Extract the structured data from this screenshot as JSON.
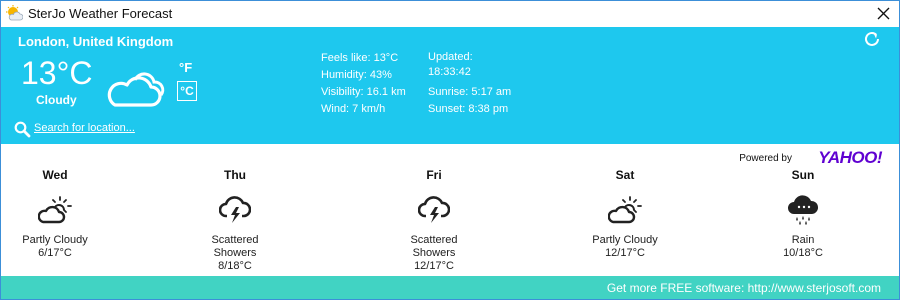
{
  "window": {
    "title": "SterJo Weather Forecast"
  },
  "current": {
    "location": "London, United Kingdom",
    "temperature": "13°C",
    "condition": "Cloudy",
    "unit_f": "°F",
    "unit_c": "°C",
    "feels_like": "Feels like: 13°C",
    "humidity": "Humidity: 43%",
    "visibility": "Visibility: 16.1 km",
    "wind": "Wind: 7 km/h",
    "updated_label": "Updated:",
    "updated_time": "18:33:42",
    "sunrise": "Sunrise: 5:17 am",
    "sunset": "Sunset: 8:38 pm",
    "search_link": "Search for location..."
  },
  "powered": {
    "label": "Powered by",
    "logo": "YAHOO!"
  },
  "forecast": [
    {
      "day": "Wed",
      "condition_line1": "Partly Cloudy",
      "condition_line2": "",
      "temps": "6/17°C",
      "icon": "partly-cloudy-icon"
    },
    {
      "day": "Thu",
      "condition_line1": "Scattered",
      "condition_line2": "Showers",
      "temps": "8/18°C",
      "icon": "thunder-shower-icon"
    },
    {
      "day": "Fri",
      "condition_line1": "Scattered",
      "condition_line2": "Showers",
      "temps": "12/17°C",
      "icon": "thunder-shower-icon"
    },
    {
      "day": "Sat",
      "condition_line1": "Partly Cloudy",
      "condition_line2": "",
      "temps": "12/17°C",
      "icon": "partly-cloudy-icon"
    },
    {
      "day": "Sun",
      "condition_line1": "Rain",
      "condition_line2": "",
      "temps": "10/18°C",
      "icon": "rain-icon"
    }
  ],
  "footer": {
    "text": "Get more FREE software: http://www.sterjosoft.com"
  },
  "colors": {
    "panel": "#1ec8ee",
    "footer": "#41d3c3",
    "yahoo": "#5f01d1"
  }
}
